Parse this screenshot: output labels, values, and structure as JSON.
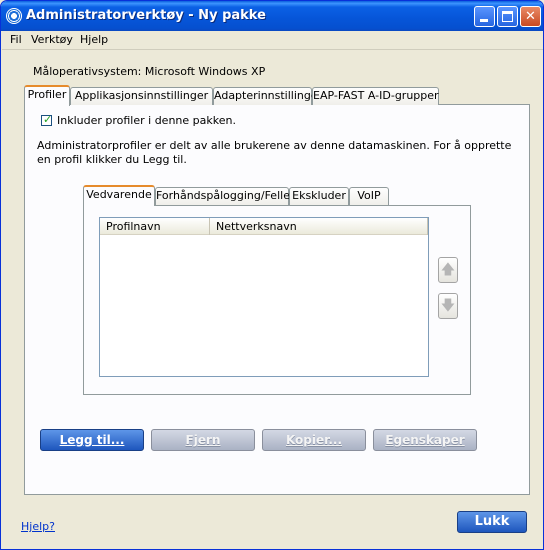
{
  "window": {
    "title": "Administratorverktøy - Ny pakke",
    "controls": {
      "minimize": "",
      "maximize": "",
      "close": "✕"
    }
  },
  "menu": [
    "Fil",
    "Verktøy",
    "Hjelp"
  ],
  "target_os": "Måloperativsystem: Microsoft Windows XP",
  "tabs": [
    "Profiler",
    "Applikasjonsinnstillinger",
    "Adapterinnstillinger",
    "EAP-FAST A-ID-grupper"
  ],
  "profiles": {
    "include_checkbox_label": "Inkluder profiler i denne pakken.",
    "include_checked": true,
    "description": "Administratorprofiler er delt av alle brukerene av denne datamaskinen. For å opprette en profil klikker du Legg til.",
    "inner_tabs": [
      "Vedvarende",
      "Forhåndspålogging/Felles",
      "Ekskluder",
      "VoIP"
    ],
    "columns": [
      "Profilnavn",
      "Nettverksnavn"
    ],
    "rows": [],
    "up_icon": "arrow-up-icon",
    "down_icon": "arrow-down-icon"
  },
  "buttons": {
    "add": "Legg til...",
    "remove": "Fjern",
    "copy": "Kopier...",
    "properties": "Egenskaper"
  },
  "footer": {
    "help": "Hjelp?",
    "close": "Lukk"
  },
  "colors": {
    "titlebar": "#0a5fdd",
    "active_tab_accent": "#e68b2c",
    "primary_button": "#1e56bd",
    "link": "#0033cc"
  }
}
